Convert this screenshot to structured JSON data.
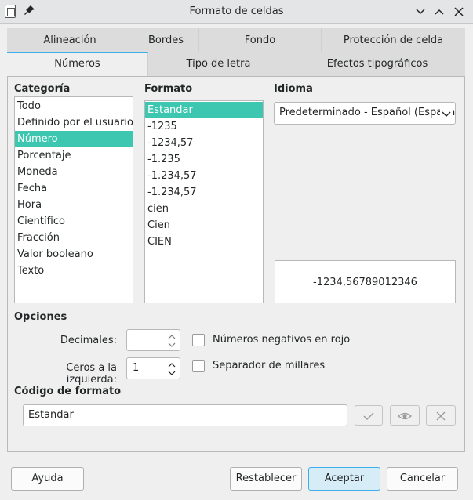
{
  "window": {
    "title": "Formato de celdas"
  },
  "tabs_row1": [
    "Alineación",
    "Bordes",
    "Fondo",
    "Protección de celda"
  ],
  "tabs_row2": [
    "Números",
    "Tipo de letra",
    "Efectos tipográficos"
  ],
  "categoria": {
    "label": "Categoría",
    "items": [
      "Todo",
      "Definido por el usuario",
      "Número",
      "Porcentaje",
      "Moneda",
      "Fecha",
      "Hora",
      "Científico",
      "Fracción",
      "Valor booleano",
      "Texto"
    ],
    "selected": "Número"
  },
  "formato": {
    "label": "Formato",
    "items": [
      "Estandar",
      "-1235",
      "-1234,57",
      "-1.235",
      "-1.234,57",
      "-1.234,57",
      "cien",
      "Cien",
      "CIEN"
    ],
    "selected": "Estandar"
  },
  "idioma": {
    "label": "Idioma",
    "value": "Predeterminado - Español (España)"
  },
  "preview": {
    "value": "-1234,56789012346"
  },
  "opciones": {
    "label": "Opciones",
    "decimales_label": "Decimales:",
    "decimales_value": "",
    "ceros_label": "Ceros a la izquierda:",
    "ceros_value": "1",
    "negativos_label": "Números negativos en rojo",
    "negativos_checked": false,
    "millares_label": "Separador de millares",
    "millares_checked": false
  },
  "codigo": {
    "label": "Código de formato",
    "value": "Estandar"
  },
  "buttons": {
    "ayuda": "Ayuda",
    "restablecer": "Restablecer",
    "aceptar": "Aceptar",
    "cancelar": "Cancelar"
  }
}
